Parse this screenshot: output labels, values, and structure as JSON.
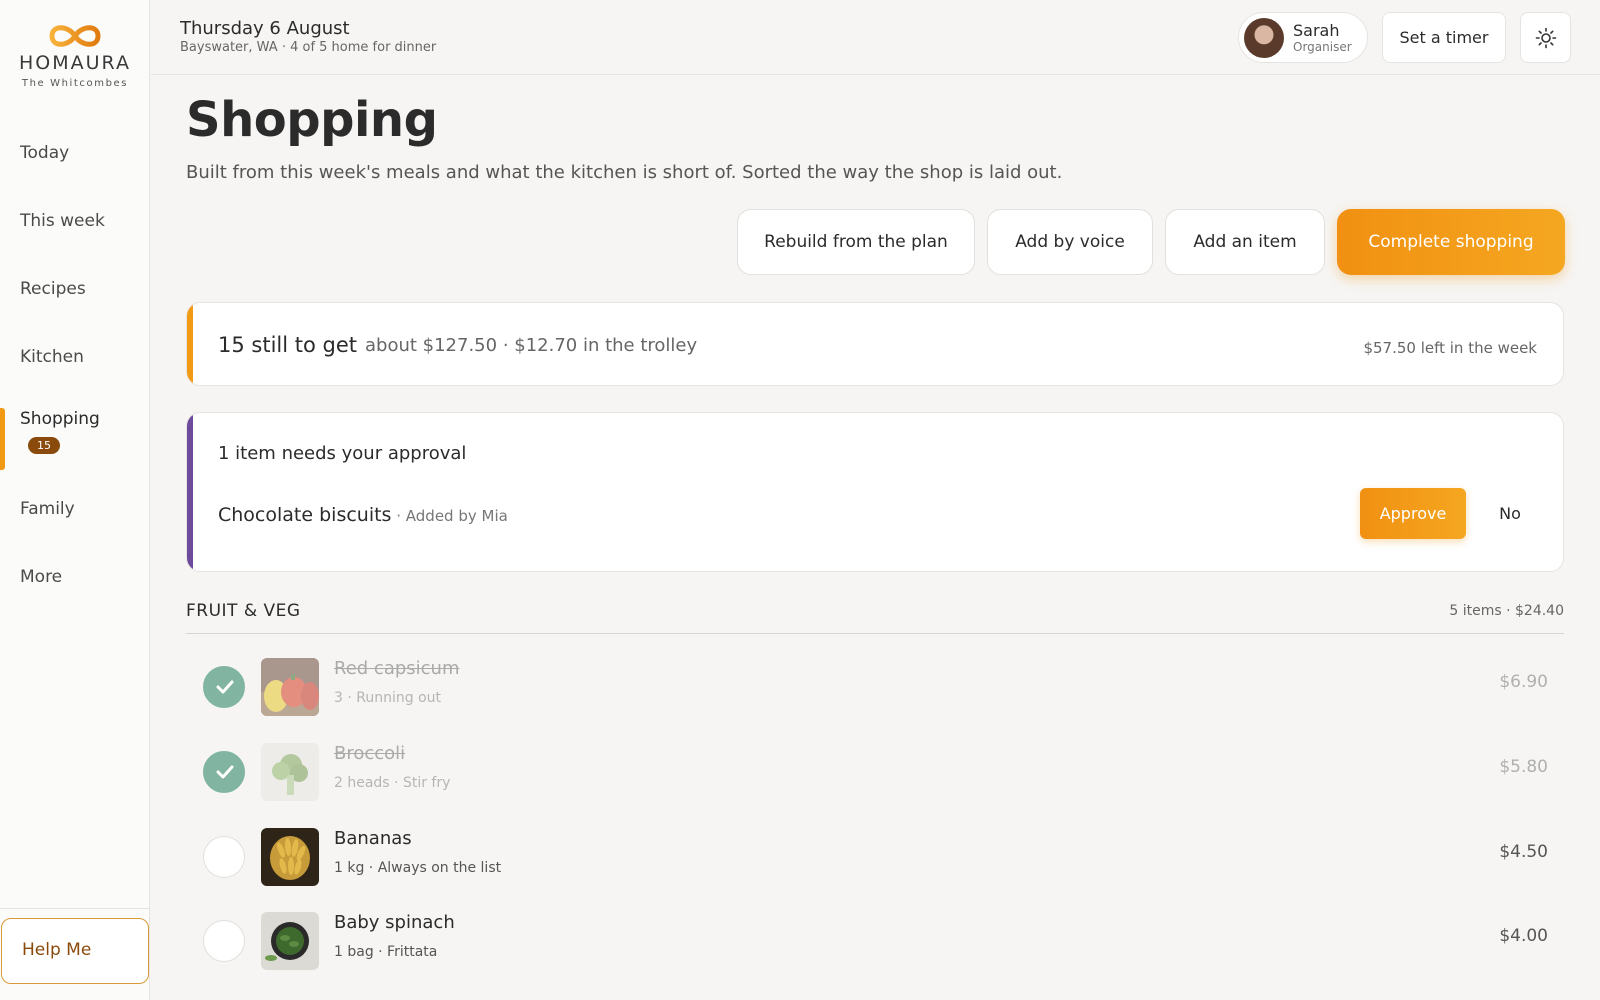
{
  "brand": {
    "name": "HOMAURA",
    "family": "The Whitcombes",
    "accent": "#f29a14"
  },
  "topbar": {
    "date": "Thursday 6 August",
    "subtitle": "Bayswater, WA · 4 of 5 home for dinner",
    "user_name": "Sarah",
    "user_role": "Organiser",
    "timer_label": "Set a timer",
    "theme_icon": "sun-icon"
  },
  "sidebar": {
    "items": [
      {
        "label": "Today"
      },
      {
        "label": "This week"
      },
      {
        "label": "Recipes"
      },
      {
        "label": "Kitchen"
      },
      {
        "label": "Shopping",
        "badge": "15",
        "active": true
      },
      {
        "label": "Family"
      },
      {
        "label": "More"
      }
    ],
    "help_label": "Help Me"
  },
  "page": {
    "title": "Shopping",
    "description": "Built from this week's meals and what the kitchen is short of. Sorted the way the shop is laid out."
  },
  "actions": {
    "rebuild": "Rebuild from the plan",
    "voice": "Add by voice",
    "add": "Add an item",
    "complete": "Complete shopping"
  },
  "summary": {
    "count_text": "15 still to get",
    "cost_text": "about $127.50 · $12.70 in the trolley",
    "budget_text": "$57.50 left in the week"
  },
  "approval": {
    "title": "1 item needs your approval",
    "item": "Chocolate biscuits",
    "added_by": " · Added by Mia",
    "approve_label": "Approve",
    "no_label": "No"
  },
  "section": {
    "title": "FRUIT & VEG",
    "meta": "5 items · $24.40",
    "items": [
      {
        "name": "Red capsicum",
        "meta": "3 · Running out",
        "price": "$6.90",
        "done": true
      },
      {
        "name": "Broccoli",
        "meta": "2 heads · Stir fry",
        "price": "$5.80",
        "done": true
      },
      {
        "name": "Bananas",
        "meta": "1 kg · Always on the list",
        "price": "$4.50",
        "done": false
      },
      {
        "name": "Baby spinach",
        "meta": "1 bag · Frittata",
        "price": "$4.00",
        "done": false
      }
    ]
  }
}
